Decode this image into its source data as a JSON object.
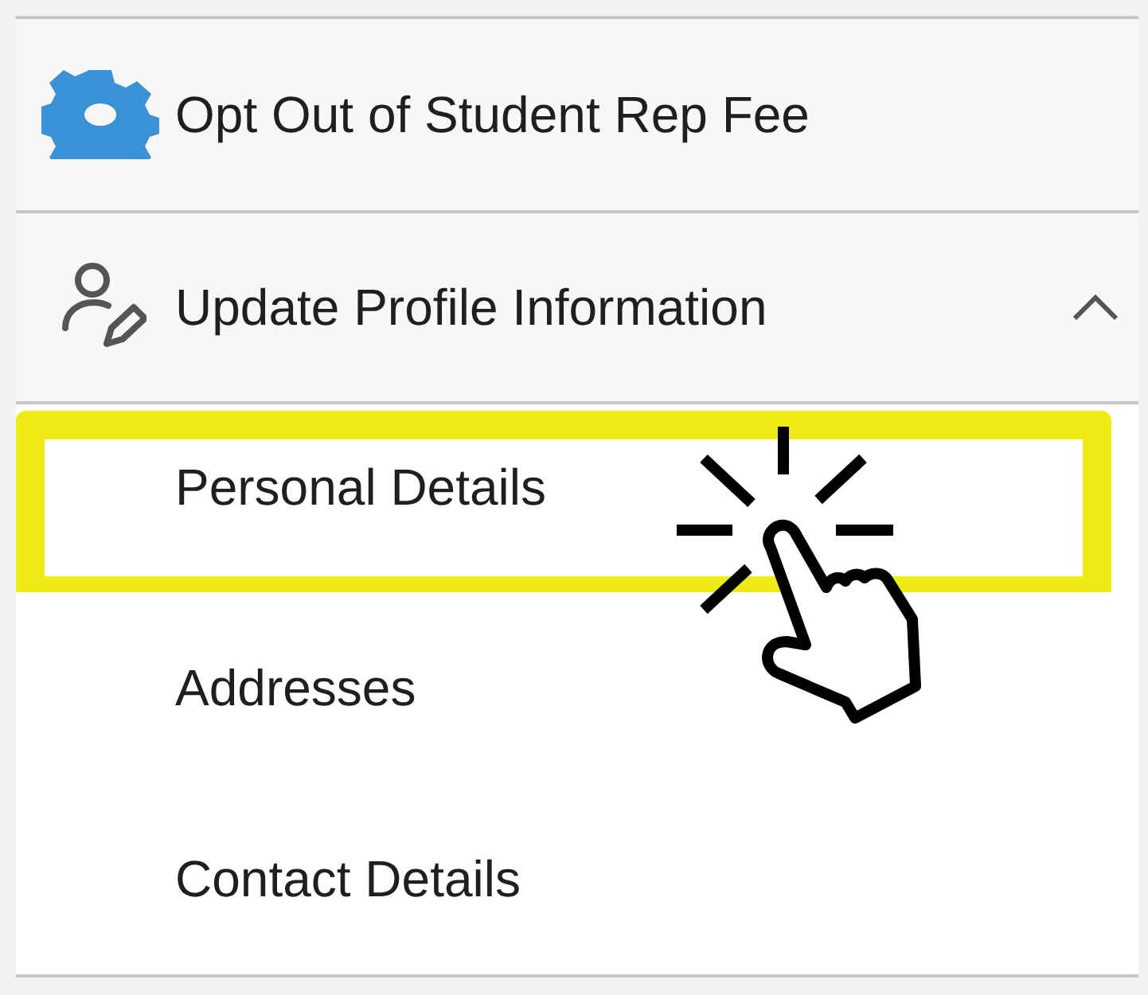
{
  "menu": [
    {
      "kind": "action",
      "label": "Opt Out of Student Rep Fee"
    },
    {
      "kind": "group",
      "label": "Update Profile Information",
      "expanded": true,
      "children": [
        {
          "label": "Personal Details",
          "highlighted": true
        },
        {
          "label": "Addresses",
          "highlighted": false
        },
        {
          "label": "Contact Details",
          "highlighted": false
        }
      ]
    }
  ]
}
